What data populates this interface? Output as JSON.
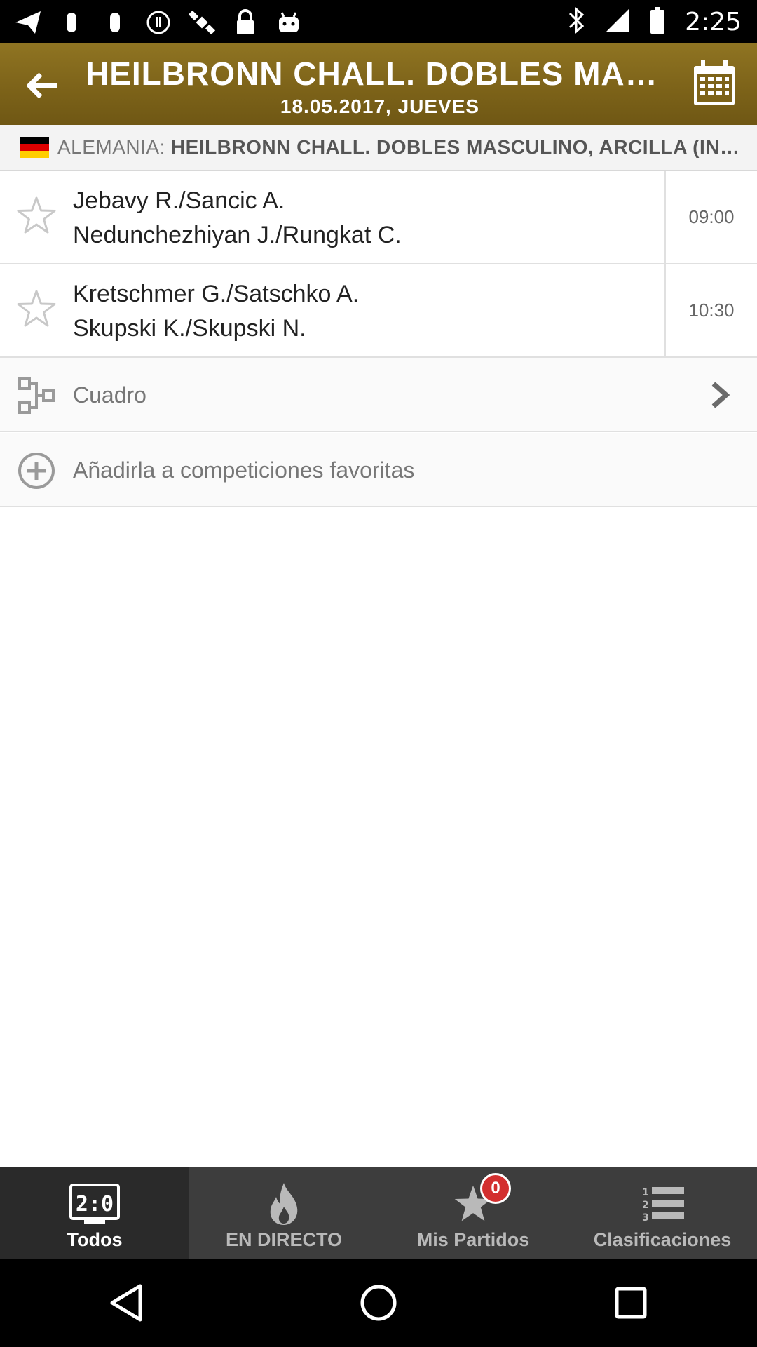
{
  "status_bar": {
    "time": "2:25",
    "icons": [
      "send-icon",
      "pause-icon",
      "pause-icon",
      "info-icon",
      "satellite-icon",
      "lock-icon",
      "android-icon",
      "bluetooth-icon",
      "signal-icon",
      "battery-icon"
    ]
  },
  "header": {
    "title": "HEILBRONN CHALL. DOBLES MAS...",
    "date": "18.05.2017, JUEVES",
    "background": "#7d6319"
  },
  "league": {
    "country": "ALEMANIA:",
    "name": "HEILBRONN CHALL. DOBLES MASCULINO, ARCILLA (IND...",
    "flag_colors": [
      "#000000",
      "#dd0000",
      "#ffce00"
    ]
  },
  "matches": [
    {
      "team1": "Jebavy R./Sancic A.",
      "team2": "Nedunchezhiyan J./Rungkat C.",
      "time": "09:00"
    },
    {
      "team1": "Kretschmer G./Satschko A.",
      "team2": "Skupski K./Skupski N.",
      "time": "10:30"
    }
  ],
  "links": {
    "draw_label": "Cuadro",
    "add_favorite_label": "Añadirla a competiciones favoritas"
  },
  "bottom_nav": {
    "items": [
      {
        "label": "Todos",
        "icon": "score-icon",
        "icon_text": "2:0",
        "active": true
      },
      {
        "label": "EN DIRECTO",
        "icon": "flame-icon",
        "active": false
      },
      {
        "label": "Mis Partidos",
        "icon": "star-icon",
        "badge": "0",
        "active": false
      },
      {
        "label": "Clasificaciones",
        "icon": "ranking-list-icon",
        "active": false
      }
    ]
  }
}
